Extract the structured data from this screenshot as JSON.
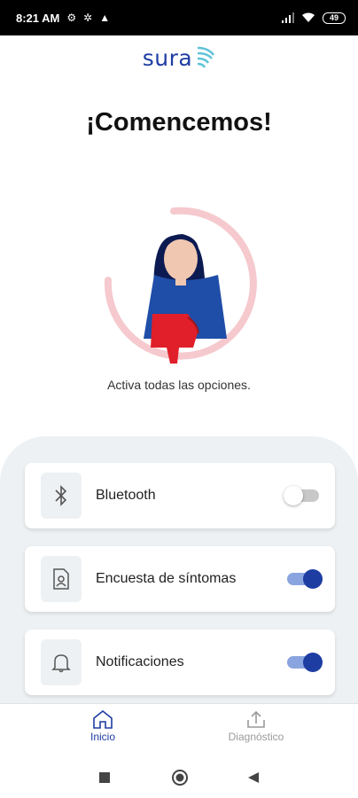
{
  "status_bar": {
    "time": "8:21 AM",
    "battery": "49"
  },
  "brand": {
    "logo_text": "sura",
    "accent": "#1e3da3"
  },
  "title": "¡Comencemos!",
  "subtitle": "Activa todas las opciones.",
  "options": [
    {
      "label": "Bluetooth",
      "icon": "bluetooth-icon",
      "enabled": false
    },
    {
      "label": "Encuesta de síntomas",
      "icon": "symptom-survey-icon",
      "enabled": true
    },
    {
      "label": "Notificaciones",
      "icon": "bell-icon",
      "enabled": true
    }
  ],
  "bottom_nav": {
    "items": [
      {
        "label": "Inicio",
        "icon": "home-icon",
        "active": true
      },
      {
        "label": "Diagnóstico",
        "icon": "upload-icon",
        "active": false
      }
    ]
  },
  "system_nav": [
    "recents-icon",
    "home-circle-icon",
    "back-icon"
  ]
}
